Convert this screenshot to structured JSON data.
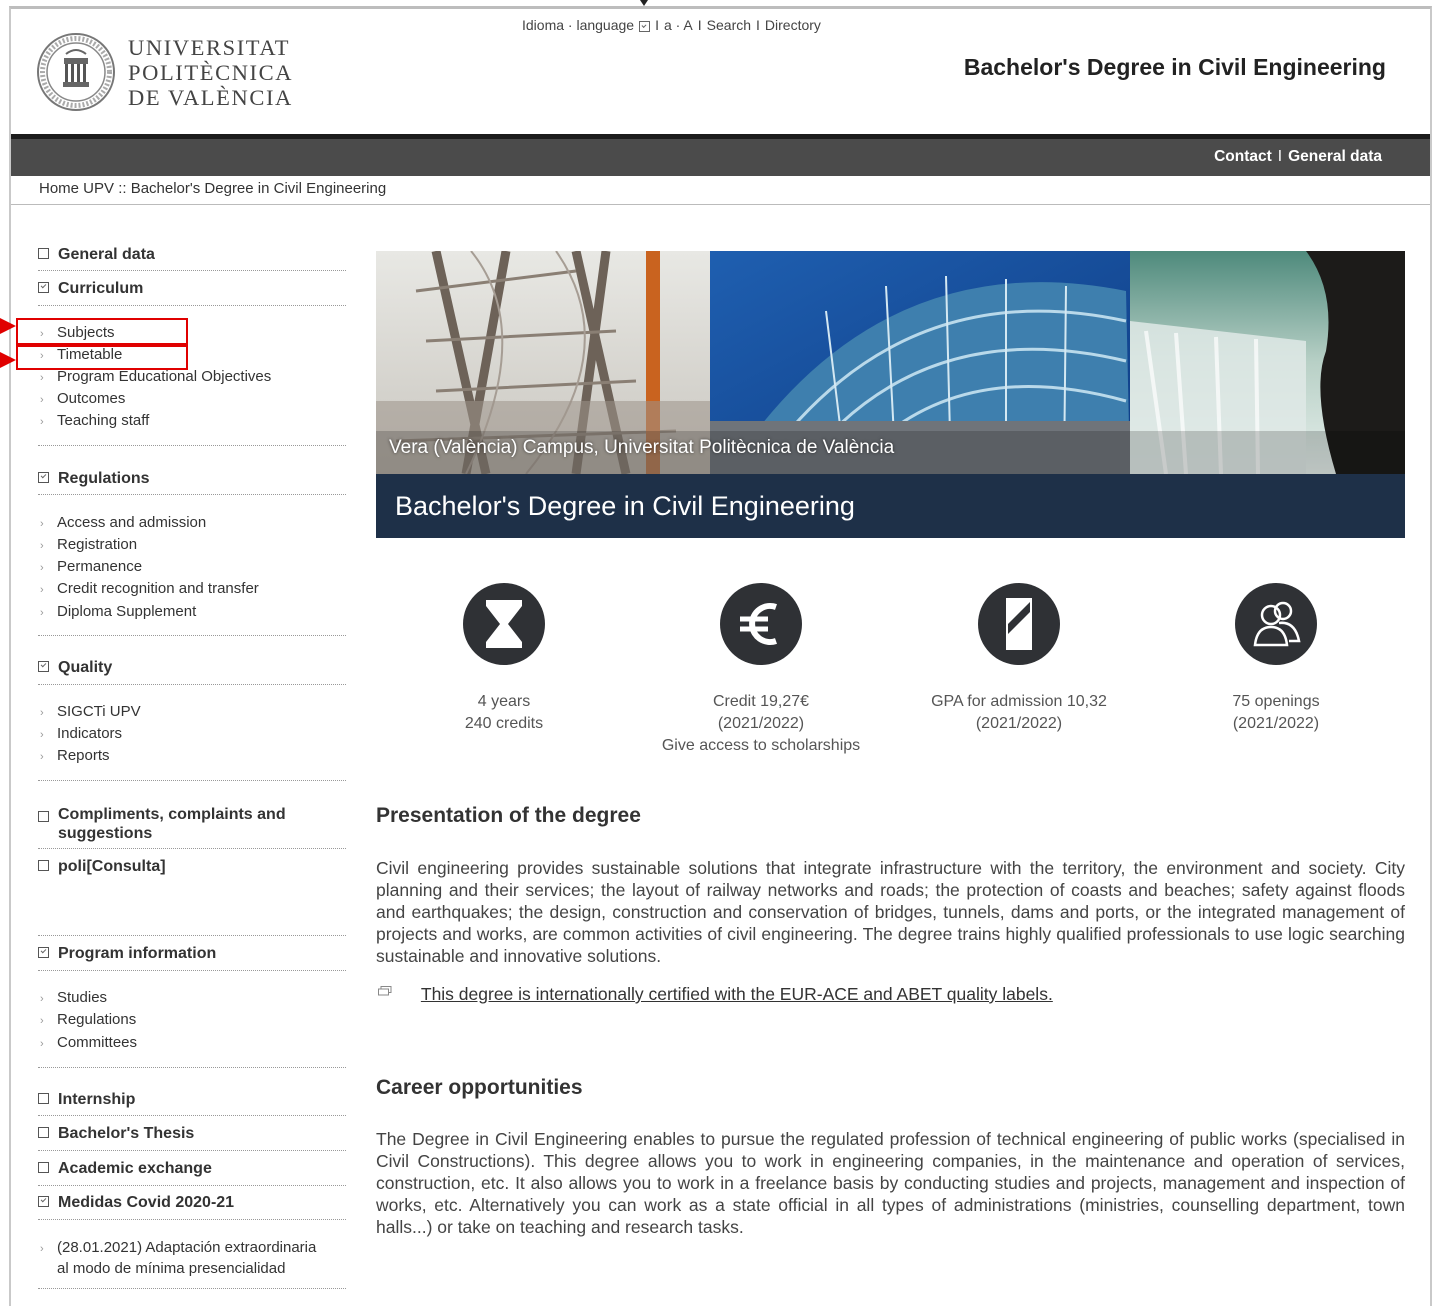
{
  "header": {
    "logo_lines": [
      "UNIVERSITAT",
      "POLITÈCNICA",
      "DE VALÈNCIA"
    ],
    "top_links": {
      "language": "Idioma · language",
      "separator": "I",
      "font_size": "a · A",
      "search": "Search",
      "directory": "Directory"
    },
    "site_title": "Bachelor's Degree in Civil Engineering",
    "bar_links": {
      "contact": "Contact",
      "separator": "I",
      "general_data": "General data"
    }
  },
  "breadcrumb": "Home UPV :: Bachelor's Degree in Civil Engineering",
  "sidebar": {
    "general_data": "General data",
    "curriculum": {
      "label": "Curriculum",
      "items": [
        "Subjects",
        "Timetable",
        "Program Educational Objectives",
        "Outcomes",
        "Teaching staff"
      ]
    },
    "regulations": {
      "label": "Regulations",
      "items": [
        "Access and admission",
        "Registration",
        "Permanence",
        "Credit recognition and transfer",
        "Diploma Supplement"
      ]
    },
    "quality": {
      "label": "Quality",
      "items": [
        "SIGCTi UPV",
        "Indicators",
        "Reports"
      ]
    },
    "compliments": [
      "Compliments, complaints and",
      "suggestions"
    ],
    "policonsulta": "poli[Consulta]",
    "program_information": {
      "label": "Program information",
      "items": [
        "Studies",
        "Regulations",
        "Committees"
      ]
    },
    "internship": "Internship",
    "bachelors_thesis": "Bachelor's Thesis",
    "academic_exchange": "Academic exchange",
    "covid": {
      "label": "Medidas Covid 2020-21",
      "items": [
        "(28.01.2021) Adaptación extraordinaria",
        "al modo de mínima presencialidad"
      ]
    }
  },
  "hero": {
    "caption": "Vera (València) Campus, Universitat Politècnica de València",
    "title": "Bachelor's Degree in Civil Engineering"
  },
  "stats": [
    {
      "icon": "hourglass-icon",
      "lines": [
        "4 years",
        "240 credits"
      ]
    },
    {
      "icon": "euro-icon",
      "lines": [
        "Credit 19,27€",
        "(2021/2022)",
        "Give access to scholarships"
      ]
    },
    {
      "icon": "gpa-icon",
      "lines": [
        "GPA for admission 10,32",
        "(2021/2022)"
      ]
    },
    {
      "icon": "people-icon",
      "lines": [
        "75 openings",
        "(2021/2022)"
      ]
    }
  ],
  "presentation": {
    "heading": "Presentation of the degree",
    "text": "Civil engineering provides sustainable solutions that integrate infrastructure with the territory, the environment and society. City planning and their services; the layout of railway networks and roads; the protection of coasts and beaches; safety against floods and earthquakes; the design, construction and conservation of bridges, tunnels, dams and ports, or the integrated management of projects and works, are common activities of civil engineering. The degree trains highly qualified professionals to use logic searching sustainable and innovative solutions.",
    "cert_link": "This degree is internationally certified with the EUR-ACE and ABET quality labels."
  },
  "career": {
    "heading": "Career opportunities",
    "text": "The Degree in Civil Engineering enables to pursue the regulated profession of technical engineering of public works (specialised in Civil Constructions). This degree allows you to work in engineering companies, in the maintenance and operation of services, construction, etc. It also allows you to work in a freelance basis by conducting studies and projects, management and inspection of works, etc. Alternatively you can work as a state official in all types of administrations (ministries, counselling department, town halls...) or take on teaching and research tasks."
  },
  "colors": {
    "hero_band": "#1e3048",
    "dark_bar": "#4b4b4b",
    "annotation_red": "#e00000"
  }
}
